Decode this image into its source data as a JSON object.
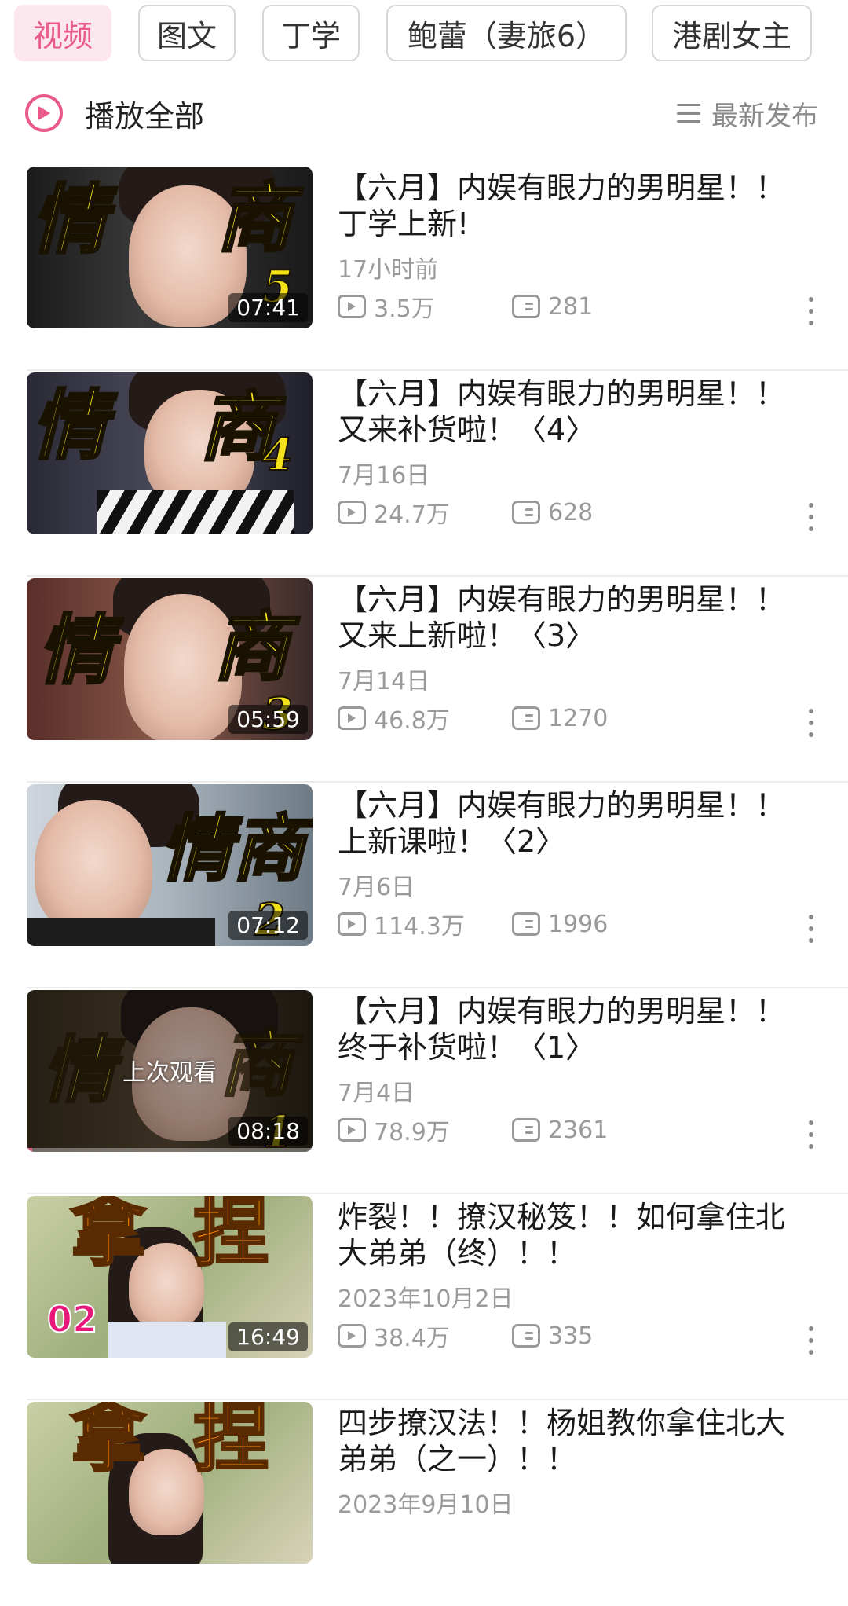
{
  "tabs": [
    {
      "label": "视频",
      "active": true
    },
    {
      "label": "图文",
      "active": false
    },
    {
      "label": "丁学",
      "active": false
    },
    {
      "label": "鲍蕾（妻旅6）",
      "active": false
    },
    {
      "label": "港剧女主",
      "active": false
    }
  ],
  "play_all": {
    "label": "播放全部",
    "icon": "play-circle-icon"
  },
  "sort": {
    "label": "最新发布",
    "icon": "list-icon"
  },
  "accent_color": "#e85a8a",
  "videos": [
    {
      "thumb_text": "情商",
      "thumb_num": "5",
      "duration": "07:41",
      "title": "【六月】内娱有眼力的男明星！！丁学上新!",
      "date": "17小时前",
      "views": "3.5万",
      "comments": "281"
    },
    {
      "thumb_text": "情商",
      "thumb_num": "4",
      "duration": "",
      "title": "【六月】内娱有眼力的男明星！！又来补货啦！〈4〉",
      "date": "7月16日",
      "views": "24.7万",
      "comments": "628"
    },
    {
      "thumb_text": "情商",
      "thumb_num": "3",
      "duration": "05:59",
      "title": "【六月】内娱有眼力的男明星！！又来上新啦！〈3〉",
      "date": "7月14日",
      "views": "46.8万",
      "comments": "1270"
    },
    {
      "thumb_text": "情商",
      "thumb_num": "2",
      "duration": "07:12",
      "title": "【六月】内娱有眼力的男明星！！上新课啦！〈2〉",
      "date": "7月6日",
      "views": "114.3万",
      "comments": "1996"
    },
    {
      "thumb_text": "情商",
      "thumb_num": "1",
      "duration": "08:18",
      "last_watched": "上次观看",
      "progress": 0.02,
      "title": "【六月】内娱有眼力的男明星！！终于补货啦！〈1〉",
      "date": "7月4日",
      "views": "78.9万",
      "comments": "2361"
    },
    {
      "thumb_text": "拿捏",
      "thumb_num": "02",
      "duration": "16:49",
      "title": "炸裂！！撩汉秘笈！！如何拿住北大弟弟（终）！！",
      "date": "2023年10月2日",
      "views": "38.4万",
      "comments": "335"
    },
    {
      "thumb_text": "拿捏",
      "thumb_num": "",
      "duration": "",
      "title": "四步撩汉法！！杨姐教你拿住北大弟弟（之一）！！",
      "date": "2023年9月10日",
      "views": "",
      "comments": ""
    }
  ]
}
